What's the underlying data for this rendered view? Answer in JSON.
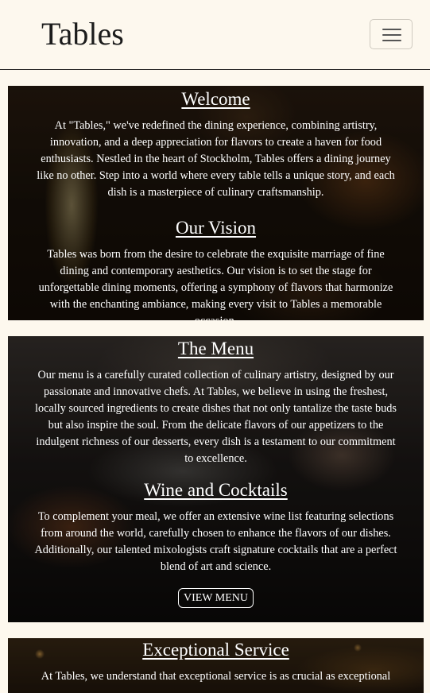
{
  "header": {
    "brand": "Tables",
    "menu_toggle_label": "Toggle navigation"
  },
  "sections": [
    {
      "title": "Welcome",
      "body": "At \"Tables,\" we've redefined the dining experience, combining artistry, innovation, and a deep appreciation for flavors to create a haven for food enthusiasts. Nestled in the heart of Stockholm, Tables offers a dining journey like no other. Step into a world where every table tells a unique story, and each dish is a masterpiece of culinary craftsmanship."
    },
    {
      "title": "Our Vision",
      "body": "Tables was born from the desire to celebrate the exquisite marriage of fine dining and contemporary aesthetics. Our vision is to set the stage for unforgettable dining moments, offering a symphony of flavors that harmonize with the enchanting ambiance, making every visit to Tables a memorable occasion."
    },
    {
      "title": "The Menu",
      "body": "Our menu is a carefully curated collection of culinary artistry, designed by our passionate and innovative chefs. At Tables, we believe in using the freshest, locally sourced ingredients to create dishes that not only tantalize the taste buds but also inspire the soul. From the delicate flavors of our appetizers to the indulgent richness of our desserts, every dish is a testament to our commitment to excellence."
    },
    {
      "title": "Wine and Cocktails",
      "body": "To complement your meal, we offer an extensive wine list featuring selections from around the world, carefully chosen to enhance the flavors of our dishes. Additionally, our talented mixologists craft signature cocktails that are a perfect blend of art and science."
    },
    {
      "title": "Exceptional Service",
      "body": "At Tables, we understand that exceptional service is as crucial as exceptional"
    }
  ],
  "buttons": {
    "view_menu": "VIEW MENU"
  },
  "icons": {
    "menu_toggle": "hamburger-icon"
  },
  "colors": {
    "page_background": "#fdf8ee",
    "text_on_image": "#ffffff",
    "brand_text": "#1c1c1c"
  }
}
